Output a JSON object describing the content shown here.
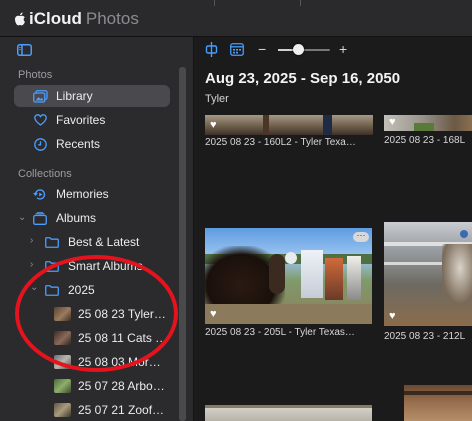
{
  "window": {
    "brand_primary": "iCloud",
    "brand_secondary": "Photos"
  },
  "sidebar": {
    "section_photos": "Photos",
    "section_collections": "Collections",
    "items": [
      {
        "label": "Library",
        "icon": "library-icon",
        "selected": true
      },
      {
        "label": "Favorites",
        "icon": "heart-icon"
      },
      {
        "label": "Recents",
        "icon": "clock-icon"
      },
      {
        "label": "Memories",
        "icon": "memories-icon"
      },
      {
        "label": "Albums",
        "icon": "albums-icon",
        "expanded": true
      },
      {
        "label": "Best & Latest",
        "icon": "folder-icon"
      },
      {
        "label": "Smart Albums",
        "icon": "folder-icon"
      },
      {
        "label": "2025",
        "icon": "folder-icon",
        "expanded": true
      },
      {
        "label": "25 08 23 Tyler…",
        "icon": "album-thumbnail"
      },
      {
        "label": "25 08 11 Cats …",
        "icon": "album-thumbnail"
      },
      {
        "label": "25 08 03 Mor…",
        "icon": "album-thumbnail"
      },
      {
        "label": "25 07 28 Arbo…",
        "icon": "album-thumbnail"
      },
      {
        "label": "25 07 21 Zoof…",
        "icon": "album-thumbnail"
      }
    ]
  },
  "toolbar": {
    "zoom_minus": "−",
    "zoom_plus": "+",
    "zoom_level": 0.4
  },
  "main": {
    "date_range": "Aug 23, 2025 - Sep 16, 2050",
    "location": "Tyler",
    "photos": [
      {
        "caption": "2025 08 23 - 160L2 - Tyler Texa…",
        "favorite": true
      },
      {
        "caption": "2025 08 23 - 168L",
        "favorite": true
      },
      {
        "caption": "2025 08 23 - 205L - Tyler Texas…",
        "favorite": true,
        "more_button": "···"
      },
      {
        "caption": "2025 08 23 - 212L",
        "favorite": true
      }
    ]
  },
  "colors": {
    "accent": "#4a9dff",
    "annotation": "#e3141e"
  }
}
